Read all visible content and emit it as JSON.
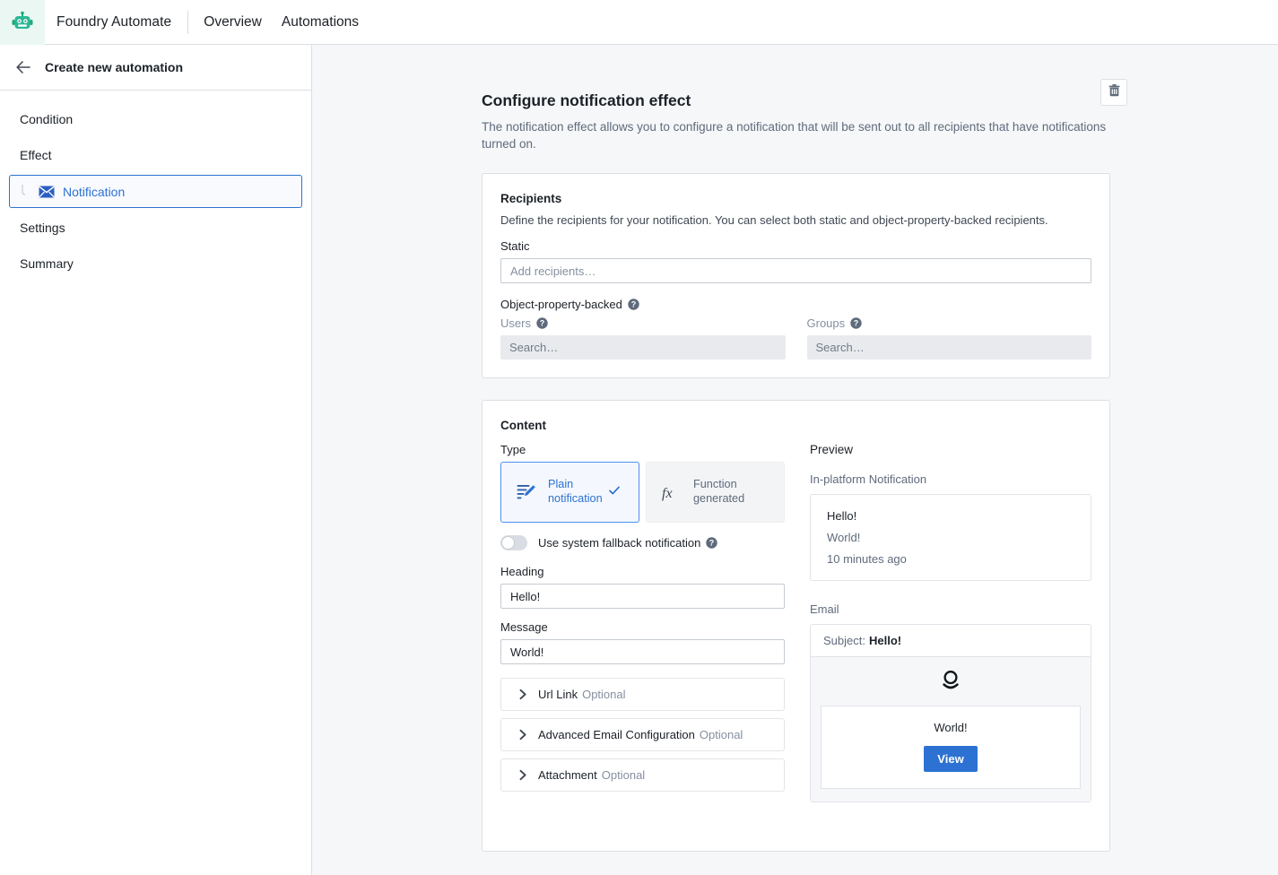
{
  "topbar": {
    "logo_icon": "robot-icon",
    "brand": "Foundry Automate",
    "nav": [
      {
        "label": "Overview"
      },
      {
        "label": "Automations"
      }
    ]
  },
  "sidebar": {
    "back_icon": "arrow-left-icon",
    "title": "Create new automation",
    "items": [
      {
        "label": "Condition",
        "selected": false
      },
      {
        "label": "Effect",
        "selected": false
      },
      {
        "label": "Notification",
        "selected": true,
        "icon": "envelope-icon",
        "sub": true
      },
      {
        "label": "Settings",
        "selected": false
      },
      {
        "label": "Summary",
        "selected": false
      }
    ]
  },
  "page": {
    "title": "Configure notification effect",
    "description": "The notification effect allows you to configure a notification that will be sent out to all recipients that have notifications turned on.",
    "delete_icon": "trash-icon"
  },
  "recipients": {
    "title": "Recipients",
    "description": "Define the recipients for your notification. You can select both static and object-property-backed recipients.",
    "static_label": "Static",
    "static_placeholder": "Add recipients…",
    "static_value": "",
    "obp_label": "Object-property-backed",
    "obp_help_icon": "help-icon",
    "users_label": "Users",
    "users_help_icon": "help-icon",
    "users_placeholder": "Search…",
    "users_value": "",
    "groups_label": "Groups",
    "groups_help_icon": "help-icon",
    "groups_placeholder": "Search…",
    "groups_value": ""
  },
  "content": {
    "title": "Content",
    "type_label": "Type",
    "types": [
      {
        "label_line1": "Plain",
        "label_line2": "notification",
        "icon": "compose-icon",
        "selected": true,
        "check_icon": "check-icon"
      },
      {
        "label_line1": "Function",
        "label_line2": "generated",
        "icon": "fx-icon",
        "selected": false
      }
    ],
    "fallback_toggle": {
      "label": "Use system fallback notification",
      "on": false,
      "help_icon": "help-icon"
    },
    "heading_label": "Heading",
    "heading_value": "Hello!",
    "message_label": "Message",
    "message_value": "World!",
    "collapsibles": [
      {
        "label": "Url Link",
        "optional": "Optional",
        "icon": "chevron-right-icon"
      },
      {
        "label": "Advanced Email Configuration",
        "optional": "Optional",
        "icon": "chevron-right-icon"
      },
      {
        "label": "Attachment",
        "optional": "Optional",
        "icon": "chevron-right-icon"
      }
    ]
  },
  "preview": {
    "title": "Preview",
    "inplatform_label": "In-platform Notification",
    "notification": {
      "heading": "Hello!",
      "body": "World!",
      "time": "10 minutes ago"
    },
    "email_label": "Email",
    "email": {
      "subject_prefix": "Subject:",
      "subject": "Hello!",
      "logo_icon": "palantir-logo-icon",
      "message": "World!",
      "button_label": "View"
    }
  },
  "colors": {
    "accent": "#2d72d2",
    "accent_light": "#4c90f0",
    "brand_green": "#1fa97f",
    "text": "#1c2127",
    "muted": "#5f6b7c",
    "placeholder": "#8590a0",
    "bg": "#f6f7f9",
    "border": "#dcdfe4"
  }
}
